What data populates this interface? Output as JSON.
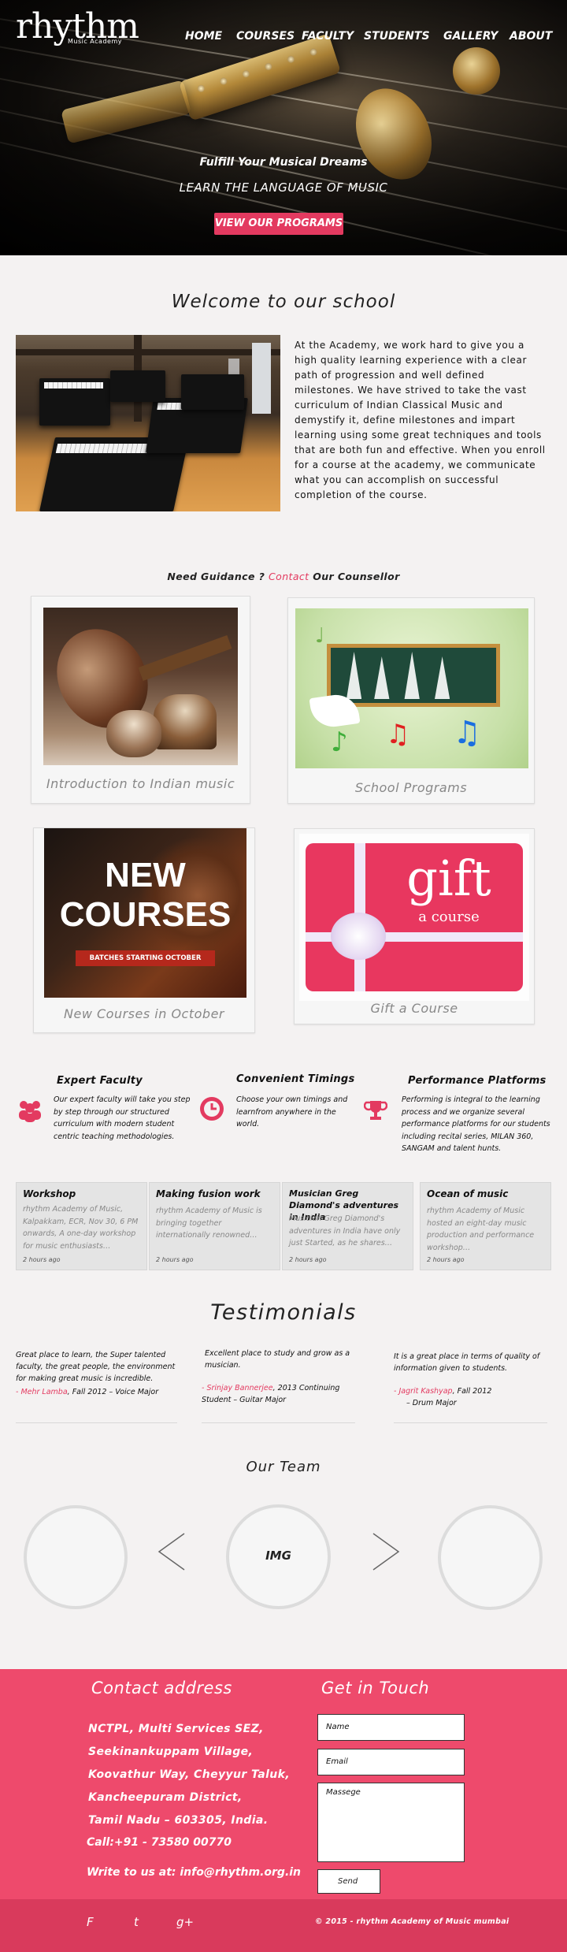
{
  "logo": {
    "word": "rhythm",
    "tagline": "Music Academy"
  },
  "nav": [
    "HOME",
    "COURSES",
    "FACULTY",
    "STUDENTS",
    "GALLERY",
    "ABOUT"
  ],
  "hero": {
    "line1": "Fulfill Your Musical Dreams",
    "line2": "LEARN THE LANGUAGE OF MUSIC",
    "button": "VIEW OUR PROGRAMS"
  },
  "welcome": {
    "title": "Welcome to our school",
    "body": "At the Academy, we work hard to give you a high quality learning experience with a clear path of progression and well defined milestones. We have strived to take the vast curriculum of Indian Classical Music and demystify it, define milestones and impart learning using some great techniques and tools that are both fun and effective. When you enroll for a course at the academy, we communicate what you can accomplish on successful completion of the course."
  },
  "guidance": {
    "before": "Need Guidance ? ",
    "link": "Contact",
    "after": " Our Counsellor"
  },
  "cards": [
    {
      "caption": "Introduction to Indian music"
    },
    {
      "caption": "School Programs"
    },
    {
      "caption": "New Courses in October",
      "poster_title_1": "NEW",
      "poster_title_2": "COURSES",
      "poster_sub": "BATCHES STARTING OCTOBER"
    },
    {
      "caption": "Gift a Course",
      "gift_word": "gift",
      "gift_sub": "a course"
    }
  ],
  "features": [
    {
      "title": "Expert Faculty",
      "text": "Our expert faculty will take you step by step through our structured curriculum with modern student centric teaching methodologies.",
      "icon": "people-icon"
    },
    {
      "title": "Convenient Timings",
      "text": "Choose your own timings and learnfrom anywhere in the world.",
      "icon": "clock-icon"
    },
    {
      "title": "Performance Platforms",
      "text": "Performing is integral to the learning process and we organize several performance platforms for our students including recital series, MILAN 360, SANGAM and talent hunts.",
      "icon": "trophy-icon"
    }
  ],
  "news": [
    {
      "title": "Workshop",
      "body": "rhythm Academy of Music, Kalpakkam, ECR, Nov 30, 6 PM onwards, A one-day workshop for music enthusiasts…",
      "time": "2 hours ago"
    },
    {
      "title": "Making fusion work",
      "body": "rhythm Academy of Music is bringing together internationally renowned…",
      "time": "2 hours ago"
    },
    {
      "title": "Musician Greg Diamond's adventures in India",
      "body": "Musician Greg Diamond's adventures in India have only just Started, as he shares…",
      "time": "2 hours ago"
    },
    {
      "title": "Ocean of music",
      "body": "rhythm Academy of Music hosted an eight-day music production and performance workshop…",
      "time": "2 hours ago"
    }
  ],
  "testimonials": {
    "title": "Testimonials",
    "items": [
      {
        "quote": "Great place to learn, the Super talented faculty, the great people, the environment for making great music is incredible.",
        "name": "- Mehr Lamba",
        "detail": ", Fall 2012 – Voice Major"
      },
      {
        "quote": "Excellent place to study and grow as a musician.",
        "name": "- Srinjay Bannerjee",
        "detail": ", 2013 Continuing Student – Guitar Major"
      },
      {
        "quote": "It is a great place in terms of quality of information given to students.",
        "name": "- Jagrit Kashyap",
        "detail": ", Fall 2012",
        "detail2": "– Drum Major"
      }
    ]
  },
  "team": {
    "title": "Our Team",
    "center_label": "IMG"
  },
  "footer": {
    "contact_title": "Contact address",
    "address_lines": [
      "NCTPL, Multi Services SEZ,",
      "Seekinankuppam Village,",
      "Koovathur Way, Cheyyur Taluk,",
      "Kancheepuram District,",
      "Tamil Nadu – 603305, India."
    ],
    "call": "Call:+91 - 73580 00770",
    "write": "Write to us at: info@rhythm.org.in",
    "touch_title": "Get in Touch",
    "form": {
      "name": "Name",
      "email": "Email",
      "message": "Massege",
      "send": "Send"
    },
    "social": [
      "F",
      "t",
      "g+"
    ],
    "copyright": "© 2015 - rhythm Academy of Music mumbai"
  },
  "colors": {
    "accent": "#e33a60",
    "footer": "#ee4a6c",
    "footer_bottom": "#d93a5c"
  }
}
